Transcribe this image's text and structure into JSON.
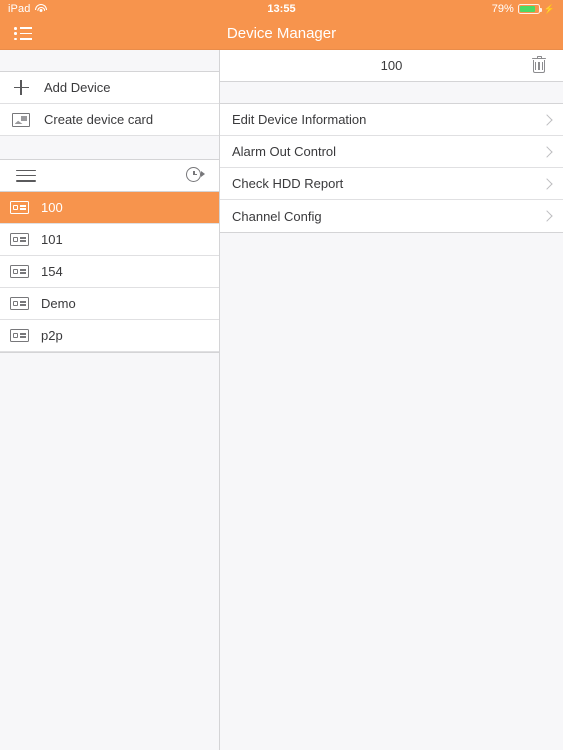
{
  "status_bar": {
    "carrier": "iPad",
    "wifi_icon": "wifi-icon",
    "time": "13:55",
    "battery_pct": "79%",
    "battery_icon": "battery-icon",
    "charging_icon": "charging-bolt-icon",
    "battery_level": 79,
    "battery_color": "#4CD964"
  },
  "navbar": {
    "menu_icon": "list-menu-icon",
    "title": "Device Manager",
    "background": "#F7944D",
    "text_color": "#FFFFFF"
  },
  "sidebar": {
    "actions": [
      {
        "label": "Add Device",
        "icon": "plus-icon"
      },
      {
        "label": "Create device card",
        "icon": "device-card-icon"
      }
    ],
    "toolbar": {
      "menu_icon": "hamburger-icon",
      "history_icon": "clock-history-icon"
    },
    "devices": [
      {
        "label": "100",
        "icon": "dvr-device-icon",
        "selected": true
      },
      {
        "label": "101",
        "icon": "dvr-device-icon",
        "selected": false
      },
      {
        "label": "154",
        "icon": "dvr-device-icon",
        "selected": false
      },
      {
        "label": "Demo",
        "icon": "dvr-device-icon",
        "selected": false
      },
      {
        "label": "p2p",
        "icon": "dvr-device-icon",
        "selected": false
      }
    ]
  },
  "detail": {
    "title": "100",
    "delete_icon": "trash-icon",
    "menu_items": [
      {
        "label": "Edit Device Information",
        "chevron": "chevron-right-icon"
      },
      {
        "label": "Alarm Out Control",
        "chevron": "chevron-right-icon"
      },
      {
        "label": "Check HDD Report",
        "chevron": "chevron-right-icon"
      },
      {
        "label": "Channel Config",
        "chevron": "chevron-right-icon"
      }
    ]
  },
  "colors": {
    "accent": "#F7944D",
    "background": "#F7F7F9",
    "row_background": "#FFFFFF",
    "separator": "#E0E0E2",
    "text": "#3A3A3C"
  }
}
